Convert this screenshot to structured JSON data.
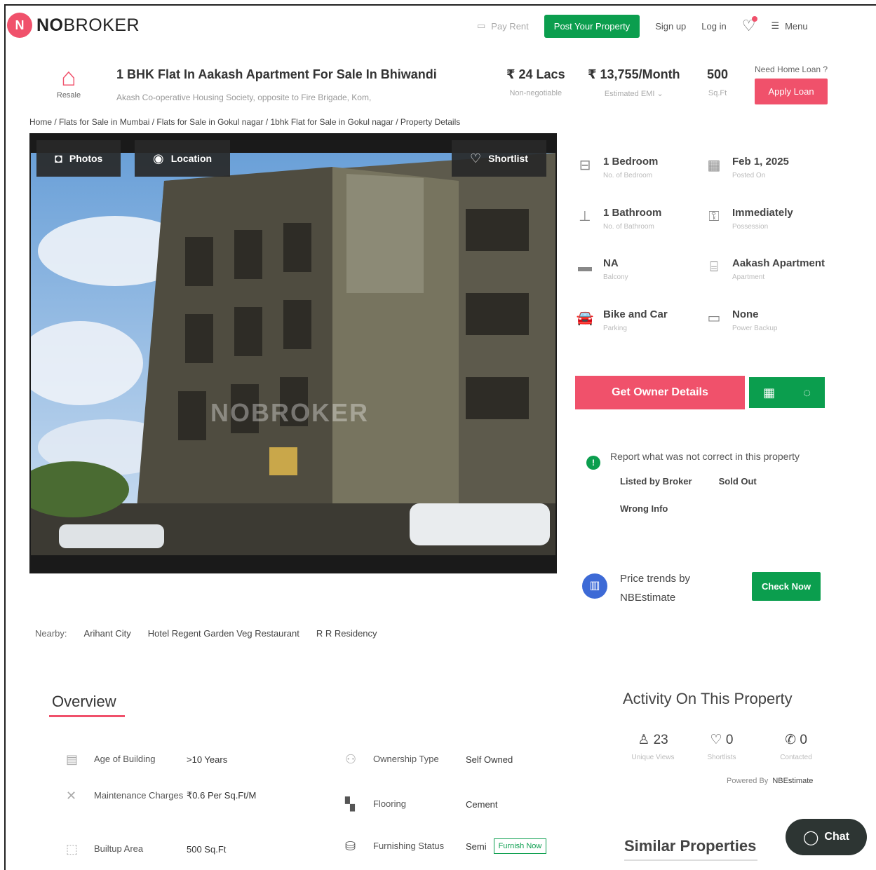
{
  "header": {
    "logo_mark": "N",
    "logo_bold": "NO",
    "logo_rest": "BROKER",
    "pay_rent": "Pay Rent",
    "post_property": "Post Your Property",
    "sign_up": "Sign up",
    "log_in": "Log in",
    "menu": "Menu"
  },
  "listing": {
    "type_label": "Resale",
    "title": "1 BHK Flat In Aakash Apartment For Sale In Bhiwandi",
    "address": "Akash Co-operative Housing Society, opposite to Fire Brigade, Kom,",
    "price": "₹ 24 Lacs",
    "price_note": "Non-negotiable",
    "emi": "₹ 13,755/Month",
    "emi_note": "Estimated EMI ⌄",
    "area": "500",
    "area_unit": "Sq.Ft",
    "loan_question": "Need Home Loan ?",
    "apply_loan": "Apply Loan"
  },
  "breadcrumb": "Home / Flats for Sale in Mumbai / Flats for Sale in Gokul nagar / 1bhk Flat for Sale in Gokul nagar / Property Details",
  "photo_tabs": {
    "photos": "Photos",
    "location": "Location",
    "shortlist": "Shortlist",
    "watermark": "NOBROKER"
  },
  "nearby": {
    "label": "Nearby:",
    "places": [
      "Arihant City",
      "Hotel Regent Garden Veg Restaurant",
      "R R Residency"
    ]
  },
  "details": [
    {
      "value": "1 Bedroom",
      "sub": "No. of Bedroom",
      "icon": "bed-icon"
    },
    {
      "value": "Feb 1, 2025",
      "sub": "Posted On",
      "icon": "calendar-icon"
    },
    {
      "value": "1 Bathroom",
      "sub": "No. of Bathroom",
      "icon": "bath-icon"
    },
    {
      "value": "Immediately",
      "sub": "Possession",
      "icon": "key-icon"
    },
    {
      "value": "NA",
      "sub": "Balcony",
      "icon": "balcony-icon"
    },
    {
      "value": "Aakash Apartment",
      "sub": "Apartment",
      "icon": "building-icon"
    },
    {
      "value": "Bike and Car",
      "sub": "Parking",
      "icon": "car-icon"
    },
    {
      "value": "None",
      "sub": "Power Backup",
      "icon": "battery-icon"
    }
  ],
  "actions": {
    "owner_details": "Get Owner Details",
    "report_text": "Report what was not correct in this property",
    "report_options": [
      "Listed by Broker",
      "Sold Out",
      "Wrong Info"
    ],
    "trend_text_1": "Price trends by",
    "trend_text_2": "NBEstimate",
    "check_now": "Check Now"
  },
  "overview": {
    "heading": "Overview",
    "rows": [
      {
        "label": "Age of Building",
        "value": ">10 Years"
      },
      {
        "label": "Ownership Type",
        "value": "Self Owned"
      },
      {
        "label": "Maintenance Charges",
        "value": "₹0.6 Per Sq.Ft/M"
      },
      {
        "label": "Flooring",
        "value": "Cement"
      },
      {
        "label": "Builtup Area",
        "value": "500 Sq.Ft"
      },
      {
        "label": "Furnishing Status",
        "value": "Semi"
      }
    ],
    "furnish_now": "Furnish Now"
  },
  "activity": {
    "heading": "Activity On This Property",
    "views": "23",
    "views_label": "Unique Views",
    "shortlists": "0",
    "shortlists_label": "Shortlists",
    "contacted": "0",
    "contacted_label": "Contacted",
    "powered_by": "Powered By",
    "powered_name": "NBEstimate"
  },
  "similar_heading": "Similar Properties",
  "chat_label": "Chat",
  "colors": {
    "brand_pink": "#f0516b",
    "brand_green": "#0b9e4e",
    "trend_blue": "#3d6ad6"
  }
}
